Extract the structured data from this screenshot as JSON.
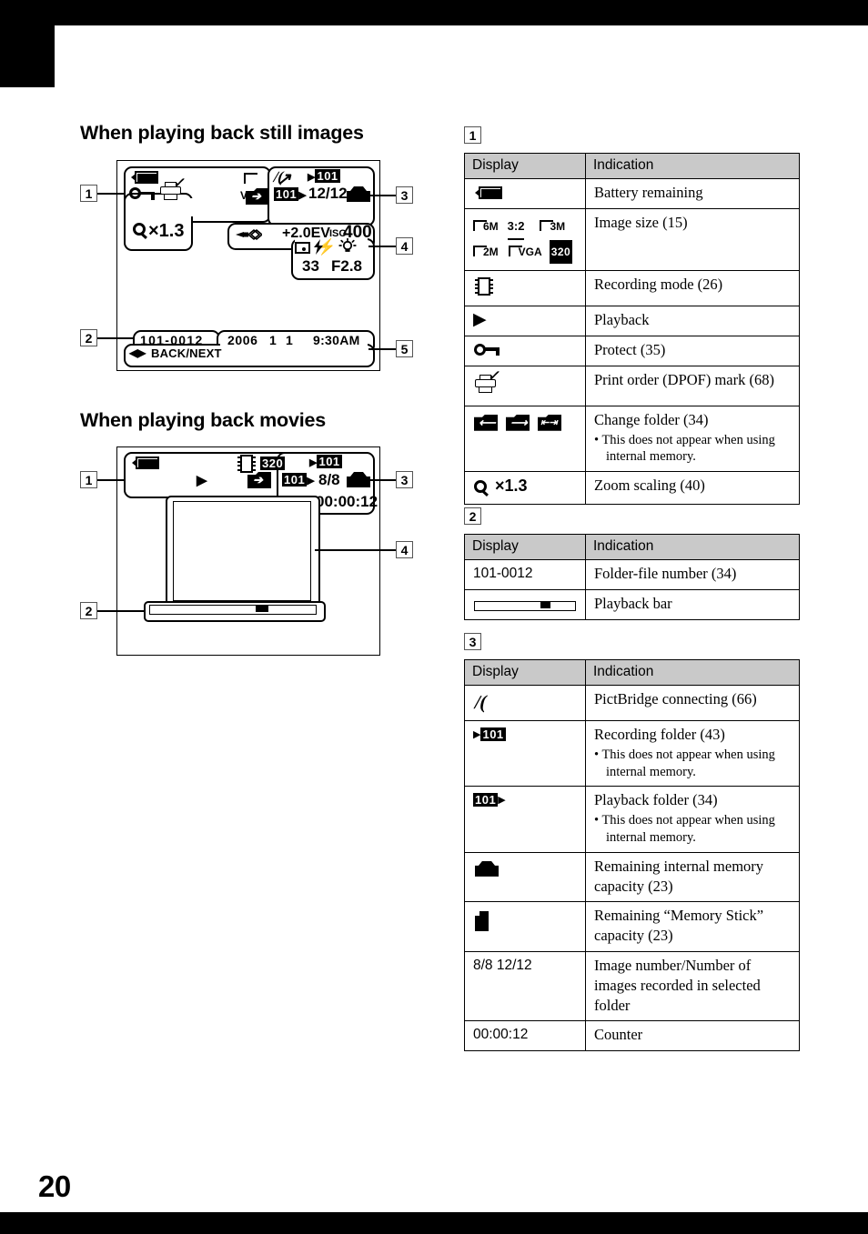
{
  "page": {
    "number": "20"
  },
  "sections": {
    "still": {
      "heading": "When playing back still images"
    },
    "movie": {
      "heading": "When playing back movies"
    }
  },
  "still_lcd": {
    "callouts": [
      "1",
      "2",
      "3",
      "4",
      "5"
    ],
    "image_size": "VGA",
    "zoom_scaling": "×1.3",
    "playback_folder": "101",
    "recording_folder": "101",
    "image_number": "12/12",
    "ev": "+2.0EV",
    "iso_label": "ISO",
    "iso_value": "400",
    "metering_flash": "",
    "shutter": "33",
    "aperture": "F2.8",
    "folder_file_number": "101-0012",
    "date": "2006",
    "month": "1",
    "day": "1",
    "time": "9:30AM",
    "back_next": "BACK/NEXT",
    "back_next_arrows": "◀▶"
  },
  "movie_lcd": {
    "callouts": [
      "1",
      "2",
      "3",
      "4"
    ],
    "movie_size": "320",
    "playback_folder": "101",
    "recording_folder": "101",
    "image_number": "8/8",
    "counter": "00:00:12",
    "play_glyph": "▶"
  },
  "tables": [
    {
      "id": "1",
      "headers": [
        "Display",
        "Indication"
      ],
      "rows": [
        {
          "display_kind": "battery",
          "display_text": "",
          "indication": "Battery remaining",
          "note": ""
        },
        {
          "display_kind": "image-sizes",
          "display_text": "",
          "indication": "Image size (15)",
          "note": "",
          "sizes": [
            "6M",
            "3:2",
            "3M",
            "2M",
            "VGA",
            "320"
          ]
        },
        {
          "display_kind": "filmstrip",
          "display_text": "",
          "indication": "Recording mode (26)",
          "note": ""
        },
        {
          "display_kind": "play",
          "display_text": "▶",
          "indication": "Playback",
          "note": ""
        },
        {
          "display_kind": "key",
          "display_text": "",
          "indication": "Protect (35)",
          "note": ""
        },
        {
          "display_kind": "printer",
          "display_text": "",
          "indication": "Print order (DPOF) mark (68)",
          "note": ""
        },
        {
          "display_kind": "folders",
          "display_text": "",
          "indication": "Change folder (34)",
          "note": "• This does not appear when using internal memory."
        },
        {
          "display_kind": "zoom",
          "display_text": "×1.3",
          "indication": "Zoom scaling (40)",
          "note": ""
        }
      ]
    },
    {
      "id": "2",
      "headers": [
        "Display",
        "Indication"
      ],
      "rows": [
        {
          "display_kind": "text",
          "display_text": "101-0012",
          "indication": "Folder-file number (34)",
          "note": ""
        },
        {
          "display_kind": "playbar",
          "display_text": "",
          "indication": "Playback bar",
          "note": ""
        }
      ]
    },
    {
      "id": "3",
      "headers": [
        "Display",
        "Indication"
      ],
      "rows": [
        {
          "display_kind": "pictbridge",
          "display_text": "",
          "indication": "PictBridge connecting (66)",
          "note": ""
        },
        {
          "display_kind": "rec-folder",
          "display_text": "101",
          "indication": "Recording folder (43)",
          "note": "• This does not appear when using internal memory."
        },
        {
          "display_kind": "play-folder",
          "display_text": "101",
          "indication": "Playback folder (34)",
          "note": "• This does not appear when using internal memory."
        },
        {
          "display_kind": "int-mem",
          "display_text": "",
          "indication": "Remaining internal memory capacity (23)",
          "note": ""
        },
        {
          "display_kind": "mem-stick",
          "display_text": "",
          "indication": "Remaining “Memory Stick” capacity (23)",
          "note": ""
        },
        {
          "display_kind": "text",
          "display_text": "8/8 12/12",
          "indication": "Image number/Number of images recorded in selected folder",
          "note": ""
        },
        {
          "display_kind": "text",
          "display_text": "00:00:12",
          "indication": "Counter",
          "note": ""
        }
      ]
    }
  ],
  "colors": {
    "header_bg": "#c9c9c9",
    "ink": "#000000",
    "paper": "#ffffff"
  }
}
